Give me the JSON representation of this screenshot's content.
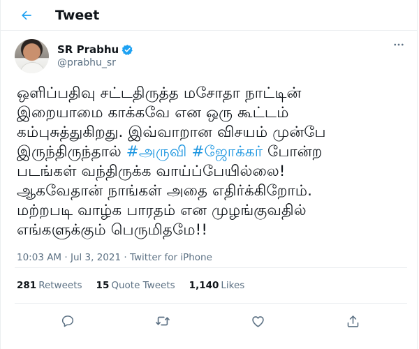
{
  "header": {
    "title": "Tweet",
    "back_icon": "back-arrow-icon"
  },
  "colors": {
    "accent": "#1da1f2",
    "hashtag": "#1b95e0",
    "text": "#0f1419",
    "muted": "#5b7083",
    "divider": "#ebeef0"
  },
  "author": {
    "name": "SR Prabhu",
    "handle": "@prabhu_sr",
    "verified": true
  },
  "tweet": {
    "lines": [
      "ஒளிப்பதிவு சட்டதிருத்த மசோதா நாட்டின்",
      "இறையாமை காக்கவே என ஒரு கூட்டம்",
      "கம்புசுத்துகிறது. இவ்வாறான விசயம் முன்பே"
    ],
    "line4_before": "இருந்திருந்தால் ",
    "hashtag1": "#அருவி",
    "hashtag2": "#ஜோக்கர்",
    "line4_after": " போன்ற",
    "lines_end": [
      "படங்கள் வந்திருக்க வாய்ப்பேயில்லை!",
      "ஆகவேதான் நாங்கள் அதை எதிர்க்கிறோம்.",
      "மற்றபடி வாழ்க பாரதம் என முழங்குவதில்",
      "எங்களுக்கும் பெருமிதமே!!"
    ]
  },
  "meta": {
    "time": "10:03 AM",
    "separator1": " · ",
    "date": "Jul 3, 2021",
    "separator2": " · ",
    "source": "Twitter for iPhone"
  },
  "stats": {
    "retweets_count": "281",
    "retweets_label": "Retweets",
    "quotes_count": "15",
    "quotes_label": "Quote Tweets",
    "likes_count": "1,140",
    "likes_label": "Likes"
  },
  "actions": [
    "reply-icon",
    "retweet-icon",
    "like-icon",
    "share-icon"
  ]
}
